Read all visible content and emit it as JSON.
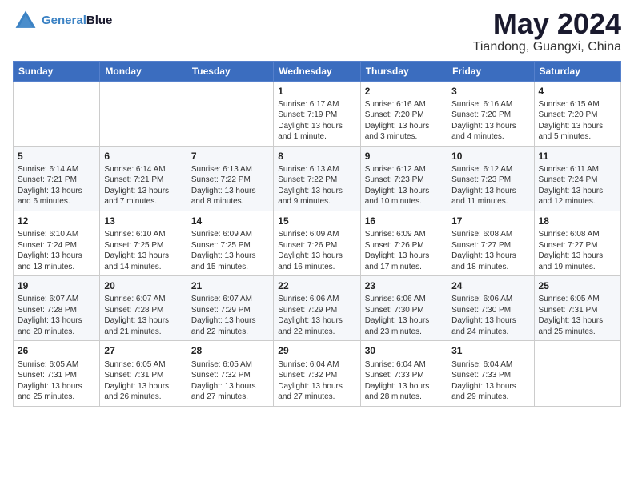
{
  "header": {
    "logo_line1": "General",
    "logo_line2": "Blue",
    "month": "May 2024",
    "location": "Tiandong, Guangxi, China"
  },
  "weekdays": [
    "Sunday",
    "Monday",
    "Tuesday",
    "Wednesday",
    "Thursday",
    "Friday",
    "Saturday"
  ],
  "weeks": [
    [
      {
        "day": "",
        "text": ""
      },
      {
        "day": "",
        "text": ""
      },
      {
        "day": "",
        "text": ""
      },
      {
        "day": "1",
        "text": "Sunrise: 6:17 AM\nSunset: 7:19 PM\nDaylight: 13 hours and 1 minute."
      },
      {
        "day": "2",
        "text": "Sunrise: 6:16 AM\nSunset: 7:20 PM\nDaylight: 13 hours and 3 minutes."
      },
      {
        "day": "3",
        "text": "Sunrise: 6:16 AM\nSunset: 7:20 PM\nDaylight: 13 hours and 4 minutes."
      },
      {
        "day": "4",
        "text": "Sunrise: 6:15 AM\nSunset: 7:20 PM\nDaylight: 13 hours and 5 minutes."
      }
    ],
    [
      {
        "day": "5",
        "text": "Sunrise: 6:14 AM\nSunset: 7:21 PM\nDaylight: 13 hours and 6 minutes."
      },
      {
        "day": "6",
        "text": "Sunrise: 6:14 AM\nSunset: 7:21 PM\nDaylight: 13 hours and 7 minutes."
      },
      {
        "day": "7",
        "text": "Sunrise: 6:13 AM\nSunset: 7:22 PM\nDaylight: 13 hours and 8 minutes."
      },
      {
        "day": "8",
        "text": "Sunrise: 6:13 AM\nSunset: 7:22 PM\nDaylight: 13 hours and 9 minutes."
      },
      {
        "day": "9",
        "text": "Sunrise: 6:12 AM\nSunset: 7:23 PM\nDaylight: 13 hours and 10 minutes."
      },
      {
        "day": "10",
        "text": "Sunrise: 6:12 AM\nSunset: 7:23 PM\nDaylight: 13 hours and 11 minutes."
      },
      {
        "day": "11",
        "text": "Sunrise: 6:11 AM\nSunset: 7:24 PM\nDaylight: 13 hours and 12 minutes."
      }
    ],
    [
      {
        "day": "12",
        "text": "Sunrise: 6:10 AM\nSunset: 7:24 PM\nDaylight: 13 hours and 13 minutes."
      },
      {
        "day": "13",
        "text": "Sunrise: 6:10 AM\nSunset: 7:25 PM\nDaylight: 13 hours and 14 minutes."
      },
      {
        "day": "14",
        "text": "Sunrise: 6:09 AM\nSunset: 7:25 PM\nDaylight: 13 hours and 15 minutes."
      },
      {
        "day": "15",
        "text": "Sunrise: 6:09 AM\nSunset: 7:26 PM\nDaylight: 13 hours and 16 minutes."
      },
      {
        "day": "16",
        "text": "Sunrise: 6:09 AM\nSunset: 7:26 PM\nDaylight: 13 hours and 17 minutes."
      },
      {
        "day": "17",
        "text": "Sunrise: 6:08 AM\nSunset: 7:27 PM\nDaylight: 13 hours and 18 minutes."
      },
      {
        "day": "18",
        "text": "Sunrise: 6:08 AM\nSunset: 7:27 PM\nDaylight: 13 hours and 19 minutes."
      }
    ],
    [
      {
        "day": "19",
        "text": "Sunrise: 6:07 AM\nSunset: 7:28 PM\nDaylight: 13 hours and 20 minutes."
      },
      {
        "day": "20",
        "text": "Sunrise: 6:07 AM\nSunset: 7:28 PM\nDaylight: 13 hours and 21 minutes."
      },
      {
        "day": "21",
        "text": "Sunrise: 6:07 AM\nSunset: 7:29 PM\nDaylight: 13 hours and 22 minutes."
      },
      {
        "day": "22",
        "text": "Sunrise: 6:06 AM\nSunset: 7:29 PM\nDaylight: 13 hours and 22 minutes."
      },
      {
        "day": "23",
        "text": "Sunrise: 6:06 AM\nSunset: 7:30 PM\nDaylight: 13 hours and 23 minutes."
      },
      {
        "day": "24",
        "text": "Sunrise: 6:06 AM\nSunset: 7:30 PM\nDaylight: 13 hours and 24 minutes."
      },
      {
        "day": "25",
        "text": "Sunrise: 6:05 AM\nSunset: 7:31 PM\nDaylight: 13 hours and 25 minutes."
      }
    ],
    [
      {
        "day": "26",
        "text": "Sunrise: 6:05 AM\nSunset: 7:31 PM\nDaylight: 13 hours and 25 minutes."
      },
      {
        "day": "27",
        "text": "Sunrise: 6:05 AM\nSunset: 7:31 PM\nDaylight: 13 hours and 26 minutes."
      },
      {
        "day": "28",
        "text": "Sunrise: 6:05 AM\nSunset: 7:32 PM\nDaylight: 13 hours and 27 minutes."
      },
      {
        "day": "29",
        "text": "Sunrise: 6:04 AM\nSunset: 7:32 PM\nDaylight: 13 hours and 27 minutes."
      },
      {
        "day": "30",
        "text": "Sunrise: 6:04 AM\nSunset: 7:33 PM\nDaylight: 13 hours and 28 minutes."
      },
      {
        "day": "31",
        "text": "Sunrise: 6:04 AM\nSunset: 7:33 PM\nDaylight: 13 hours and 29 minutes."
      },
      {
        "day": "",
        "text": ""
      }
    ]
  ]
}
